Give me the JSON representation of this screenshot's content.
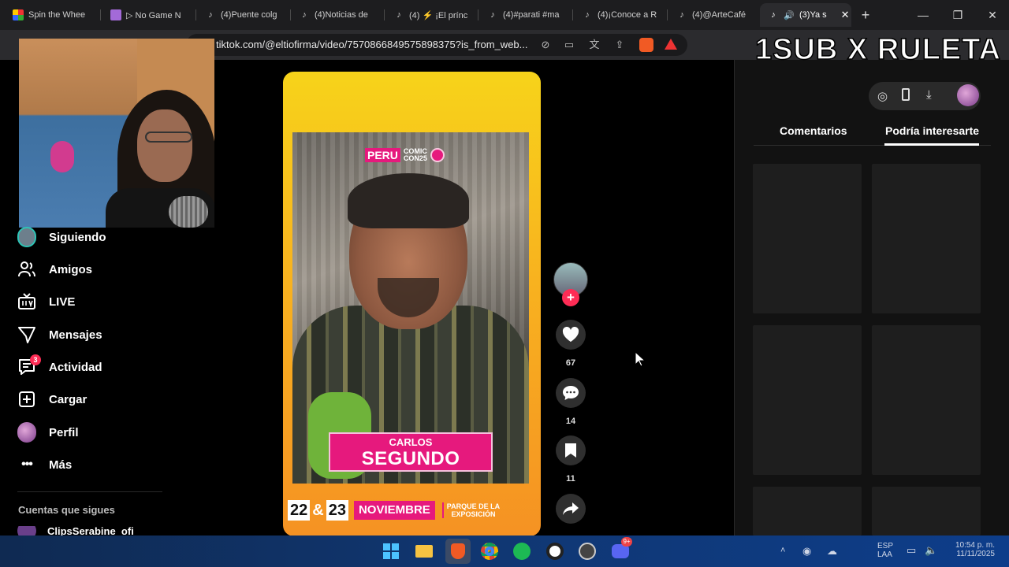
{
  "browser": {
    "tabs": [
      {
        "label": "Spin the Whee",
        "icon": "wheel-icon"
      },
      {
        "label": "▷ No Game N",
        "icon": "twitch-icon"
      },
      {
        "label": "(4)Puente colg",
        "icon": "tiktok-icon"
      },
      {
        "label": "(4)Noticias de",
        "icon": "tiktok-icon"
      },
      {
        "label": "(4) ⚡ ¡El prínc",
        "icon": "tiktok-icon"
      },
      {
        "label": "(4)#parati #ma",
        "icon": "tiktok-icon"
      },
      {
        "label": "(4)¡Conoce a R",
        "icon": "tiktok-icon"
      },
      {
        "label": "(4)@ArteCafé",
        "icon": "tiktok-icon"
      },
      {
        "label": "(3)Ya s",
        "icon": "tiktok-icon",
        "active": true
      }
    ],
    "new_tab": "+",
    "url": "tiktok.com/@eltiofirma/video/7570866849575898375?is_from_web..."
  },
  "overlay_text": "1SUB X RULETA",
  "sidebar": {
    "items": [
      {
        "label": "Siguiendo",
        "icon": "following-avatar-icon"
      },
      {
        "label": "Amigos",
        "icon": "friends-icon"
      },
      {
        "label": "LIVE",
        "icon": "live-icon"
      },
      {
        "label": "Mensajes",
        "icon": "messages-icon"
      },
      {
        "label": "Actividad",
        "icon": "activity-icon",
        "badge": "3"
      },
      {
        "label": "Cargar",
        "icon": "upload-icon"
      },
      {
        "label": "Perfil",
        "icon": "profile-avatar-icon"
      },
      {
        "label": "Más",
        "icon": "more-icon"
      }
    ],
    "section_title": "Cuentas que sigues",
    "following": [
      {
        "name": "ClipsSerabine_ofi"
      }
    ]
  },
  "video": {
    "logo_main": "PERU",
    "logo_sub1": "COMIC",
    "logo_sub2": "CON25",
    "name_line1": "CARLOS",
    "name_line2": "SEGUNDO",
    "day1": "22",
    "amp": "&",
    "day2": "23",
    "month": "NOVIEMBRE",
    "place_line1": "PARQUE DE LA",
    "place_line2": "EXPOSICIÓN"
  },
  "actions": {
    "likes": "67",
    "comments": "14",
    "saves": "11"
  },
  "right_panel": {
    "tabs": [
      "Comentarios",
      "Podría interesarte"
    ],
    "active_tab": "Podría interesarte"
  },
  "taskbar": {
    "lang1": "ESP",
    "lang2": "LAA",
    "time": "10:54 p. m.",
    "date": "11/11/2025",
    "discord_badge": "9+"
  },
  "colors": {
    "accent_pink": "#fe2c55",
    "brand_magenta": "#e6197d",
    "video_yellow": "#f7d31a"
  }
}
